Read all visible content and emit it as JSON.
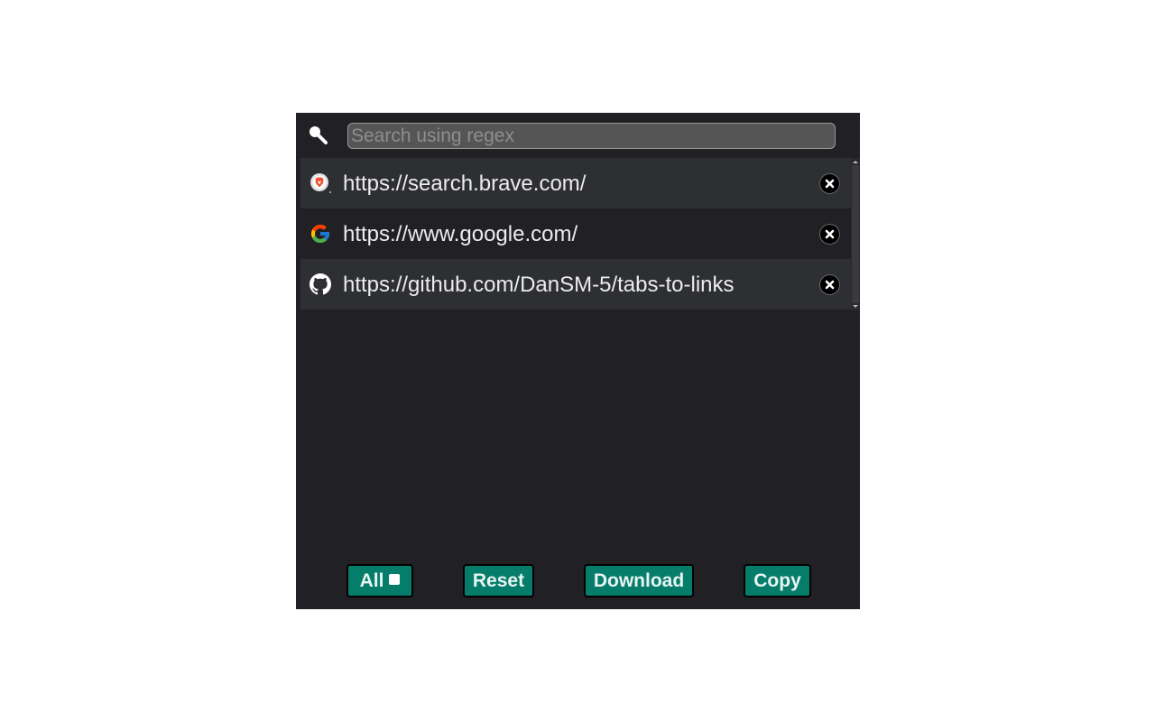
{
  "search": {
    "icon": "search-icon",
    "placeholder": "Search using regex",
    "value": ""
  },
  "tabs": [
    {
      "url": "https://search.brave.com/",
      "icon": "brave-icon"
    },
    {
      "url": "https://www.google.com/",
      "icon": "google-icon"
    },
    {
      "url": "https://github.com/DanSM-5/tabs-to-links",
      "icon": "github-icon"
    }
  ],
  "buttons": {
    "all_label": "All",
    "all_checked": false,
    "reset_label": "Reset",
    "download_label": "Download",
    "copy_label": "Copy"
  },
  "colors": {
    "background": "#212125",
    "row_alt": "#2e2f33",
    "button": "#067d6b"
  }
}
